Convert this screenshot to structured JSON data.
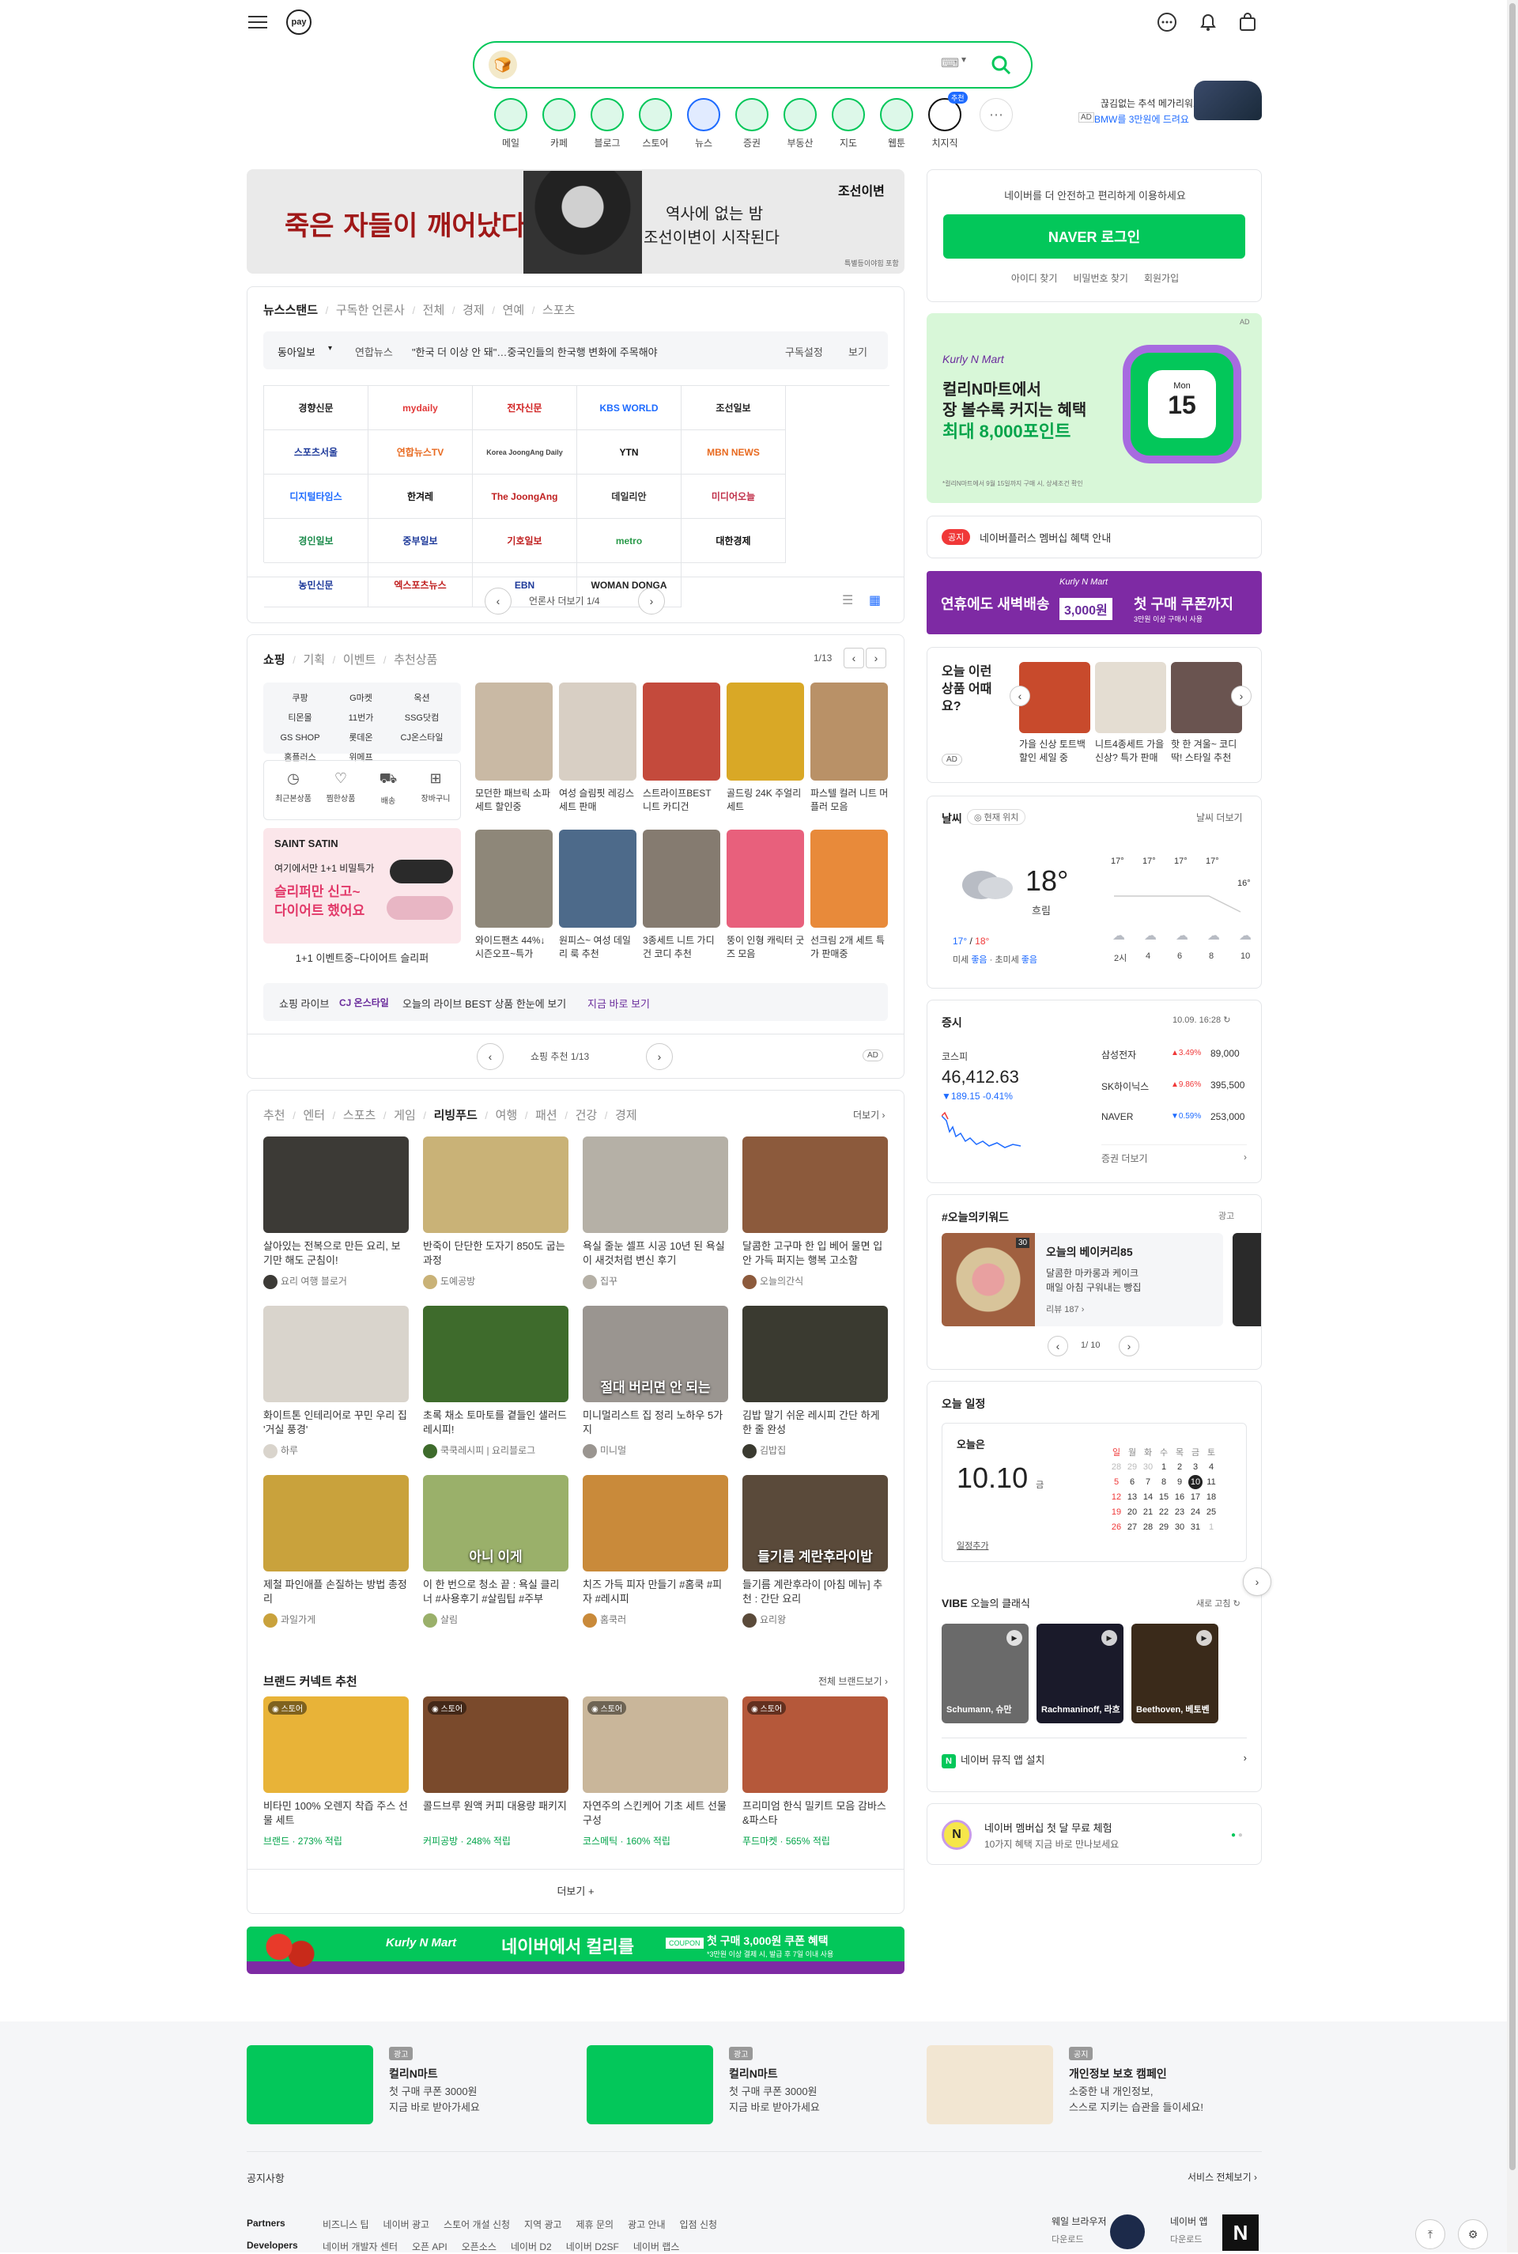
{
  "header": {
    "menu_icon": "hamburger-icon",
    "pay_label": "pay",
    "right_icons": [
      "chat-icon",
      "bell-icon",
      "shopping-bag-icon"
    ]
  },
  "search": {
    "placeholder": "",
    "keyboard_label": "⌨"
  },
  "services": [
    {
      "label": "메일",
      "color": "#03c75a"
    },
    {
      "label": "카페",
      "color": "#03c75a"
    },
    {
      "label": "블로그",
      "color": "#03c75a"
    },
    {
      "label": "스토어",
      "color": "#03c75a"
    },
    {
      "label": "뉴스",
      "color": "#1e6bff"
    },
    {
      "label": "증권",
      "color": "#03c75a"
    },
    {
      "label": "부동산",
      "color": "#03c75a"
    },
    {
      "label": "지도",
      "color": "#03c75a"
    },
    {
      "label": "웹툰",
      "color": "#03c75a"
    },
    {
      "label": "치지직",
      "color": "#111",
      "badge": "추천"
    }
  ],
  "top_ad": {
    "line1": "끊김없는 추석 메가리워드",
    "ad": "AD",
    "line2": "BMW를 3만원에 드려요"
  },
  "banner": {
    "title": "죽은 자들이 깨어났다",
    "line1": "역사에 없는 밤",
    "line2": "조선이변이 시작된다",
    "logo": "조선이변",
    "note": "특별등이야힘 포함"
  },
  "news": {
    "tabs": [
      "뉴스스탠드",
      "구독한 언론사",
      "전체",
      "경제",
      "연예",
      "스포츠"
    ],
    "ticker_source": "연합뉴스",
    "ticker_label": "동아일보",
    "headline": "\"한국 더 이상 안 돼\"…중국인들의 한국행 변화에 주목해야",
    "right_links": [
      "구독설정",
      "보기"
    ],
    "press": [
      "경향신문",
      "mydaily",
      "전자신문",
      "KBS WORLD",
      "조선일보",
      "스포츠서울",
      "연합뉴스TV",
      "Korea JoongAng Daily",
      "YTN",
      "MBN NEWS",
      "디지털타임스",
      "한겨레",
      "The JoongAng",
      "데일리안",
      "미디어오늘",
      "경인일보",
      "중부일보",
      "기호일보",
      "metro",
      "대한경제",
      "농민신문",
      "엑스포츠뉴스",
      "EBN",
      "WOMAN DONGA"
    ],
    "pager": "언론사 더보기 1/4",
    "view_icons": [
      "list-view-icon",
      "grid-view-icon"
    ]
  },
  "shopping": {
    "tabs": [
      "쇼핑",
      "기획",
      "이벤트",
      "추천상품"
    ],
    "page": "1/13",
    "malls": [
      "쿠팡",
      "G마켓",
      "옥션",
      "티몬몰",
      "11번가",
      "SSG닷컴",
      "GS SHOP",
      "롯데온",
      "CJ온스타일",
      "홈플러스",
      "위메프"
    ],
    "shortcuts": [
      "최근본상품",
      "찜한상품",
      "배송",
      "장바구니"
    ],
    "promo_brand": "SAINT SATIN",
    "promo_line1": "여기에서만 1+1 비밀특가",
    "promo_line2": "슬리퍼만 신고~",
    "promo_line3": "다이어트 했어요",
    "promo_caption": "1+1 이벤트중~다이어트 슬리퍼",
    "products": [
      {
        "name": "모던한 패브릭 소파 세트 할인중",
        "color": "#c9b9a4"
      },
      {
        "name": "여성 슬림핏 레깅스 세트 판매",
        "color": "#d8cfc4"
      },
      {
        "name": "스트라이프BEST 니트 카디건",
        "color": "#c44a3c"
      },
      {
        "name": "골드링 24K 주얼리 세트",
        "color": "#d9a826"
      },
      {
        "name": "파스텔 컬러 니트 머플러 모음",
        "color": "#b99167"
      },
      {
        "name": "와이드팬츠 44%↓ 시즌오프~특가",
        "color": "#8e8779"
      },
      {
        "name": "원피스~ 여성 데일리 룩 추천",
        "color": "#4d6a8a"
      },
      {
        "name": "3종세트 니트 가디건 코디 추천",
        "color": "#857b70"
      },
      {
        "name": "뚱이 인형 캐릭터 굿즈 모음",
        "color": "#e8607c"
      },
      {
        "name": "선크림 2개 세트 특가 판매중",
        "color": "#e88a3a"
      }
    ],
    "banner_label": "쇼핑 라이브",
    "banner_brand": "CJ 온스타일",
    "banner_text": "오늘의 라이브 BEST 상품 한눈에 보기",
    "banner_link": "지금 바로 보기",
    "pager": "쇼핑 추천 1/13",
    "ad": "AD"
  },
  "contents": {
    "tabs": [
      "추천",
      "엔터",
      "스포츠",
      "게임",
      "리빙푸드",
      "여행",
      "패션",
      "건강",
      "경제"
    ],
    "more": "더보기",
    "items": [
      {
        "caption": "살아있는 전복으로 만든 요리, 보기만 해도 군침이!",
        "author": "요리 여행 블로거",
        "color": "#3c3a36"
      },
      {
        "caption": "반죽이 단단한 도자기 850도 굽는 과정",
        "author": "도예공방",
        "color": "#c9b277"
      },
      {
        "caption": "욕실 줄눈 셀프 시공 10년 된 욕실이 새것처럼 변신 후기",
        "author": "집꾸",
        "color": "#b5b0a6"
      },
      {
        "caption": "달콤한 고구마 한 입 베어 물면 입안 가득 퍼지는 행복 고소함",
        "author": "오늘의간식",
        "color": "#8c5a3c"
      },
      {
        "caption": "화이트톤 인테리어로 꾸민 우리 집 '거실 풍경'",
        "author": "하루",
        "color": "#d9d4cc"
      },
      {
        "caption": "초록 채소 토마토를 곁들인 샐러드 레시피!",
        "author": "쿡쿡레시피 | 요리블로그",
        "color": "#3e6b2c"
      },
      {
        "caption": "미니멀리스트 집 정리 노하우 5가지",
        "author": "미니멀",
        "color": "#9a9590"
      },
      {
        "caption": "김밥 말기 쉬운 레시피 간단 하게 한 줄 완성",
        "author": "김밥집",
        "color": "#3a3a30"
      },
      {
        "caption": "제철 파인애플 손질하는 방법 총정리",
        "author": "과일가게",
        "color": "#c9a23c"
      },
      {
        "caption": "이 한 번으로 청소 끝 : 욕실 클리너 #사용후기 #살림팁 #주부",
        "author": "살림",
        "color": "#9ab06a"
      },
      {
        "caption": "치즈 가득 피자 만들기 #홈쿡 #피자 #레시피",
        "author": "홈쿡러",
        "color": "#c98a3a"
      },
      {
        "caption": "들기름 계란후라이 [아침 메뉴] 추천 : 간단 요리",
        "author": "요리왕",
        "color": "#5a4a3a"
      }
    ],
    "overlays": [
      "절대 버리면 안 되는",
      "아니 이게",
      "들기름 계란후라이밥"
    ],
    "shop_title": "브랜드 커넥트 추천",
    "shop_more": "전체 브랜드보기",
    "shop_items": [
      {
        "caption": "비타민 100% 오렌지 착즙 주스 선물 세트",
        "meta": "브랜드 · 273% 적립",
        "color": "#e8b338"
      },
      {
        "caption": "콜드브루 원액 커피 대용량 패키지",
        "meta": "커피공방 · 248% 적립",
        "color": "#7a4a2c"
      },
      {
        "caption": "자연주의 스킨케어 기초 세트 선물 구성",
        "meta": "코스메틱 · 160% 적립",
        "color": "#c9b69a"
      },
      {
        "caption": "프리미엄 한식 밀키트 모음 감바스&파스타",
        "meta": "푸드마켓 · 565% 적립",
        "color": "#b5583a"
      }
    ],
    "load_more": "더보기 +"
  },
  "bottom_ad": {
    "brand": "Kurly N Mart",
    "text": "네이버에서 컬리를",
    "coupon": "COUPON",
    "offer": "첫 구매 3,000원 쿠폰 혜택",
    "note": "*3만원 이상 결제 시, 발급 후 7일 이내 사용"
  },
  "login": {
    "prompt": "네이버를 더 안전하고 편리하게 이용하세요",
    "button": "NAVER 로그인",
    "links": [
      "아이디 찾기",
      "비밀번호 찾기",
      "회원가입"
    ]
  },
  "kurly_ad": {
    "ad": "AD",
    "brand": "Kurly N Mart",
    "line1": "컬리N마트에서",
    "line2": "장 볼수록 커지는 혜택",
    "line3": "최대 8,000포인트",
    "calendar_month": "Mon",
    "calendar_day": "15",
    "fine_print": "*컬리N마트에서 9월 15일까지 구매 시, 상세조건 확인"
  },
  "notice": {
    "badge": "공지",
    "text": "네이버플러스 멤버십 혜택 안내"
  },
  "delivery_ad": {
    "text1": "연휴에도 새벽배송",
    "brand": "Kurly N Mart",
    "amount": "3,000원",
    "text2": "첫 구매 쿠폰까지",
    "note": "3만원 이상 구매시 사용"
  },
  "today_products": {
    "title": "오늘 이런 상품 어때요?",
    "ad": "AD",
    "items": [
      {
        "caption": "가을 신상 토트백 할인 세일 중",
        "color": "#c84a2c"
      },
      {
        "caption": "니트4종세트 가을 신상? 특가 판매",
        "color": "#e4ddd2"
      },
      {
        "caption": "핫 한 겨울~ 코디 딱! 스타일 추천",
        "color": "#6a5450"
      }
    ]
  },
  "weather": {
    "title": "날씨",
    "location": "현재 위치",
    "link": "날씨 더보기",
    "temp": "18°",
    "condition": "흐림",
    "low": "17°",
    "high": "18°",
    "dust_label": "미세",
    "dust_val": "좋음",
    "ultra_label": "초미세",
    "ultra_val": "좋음",
    "hourly": [
      {
        "temp": "17°",
        "time": "2시"
      },
      {
        "temp": "17°",
        "time": "4"
      },
      {
        "temp": "17°",
        "time": "6"
      },
      {
        "temp": "17°",
        "time": "8"
      },
      {
        "temp": "16°",
        "time": "10"
      }
    ]
  },
  "stock": {
    "title": "증시",
    "time": "10.09. 16:28",
    "index_name": "코스피",
    "index_val": "46,412.63",
    "index_change": "▼189.15 -0.41%",
    "items": [
      {
        "name": "삼성전자",
        "change": "▲3.49%",
        "price": "89,000"
      },
      {
        "name": "SK하이닉스",
        "change": "▲9.86%",
        "price": "395,500"
      },
      {
        "name": "NAVER",
        "change": "▼0.59%",
        "price": "253,000"
      }
    ],
    "more": "증권 더보기"
  },
  "hashtag": {
    "title": "#오늘의키워드",
    "page_label": "광고",
    "item_title": "오늘의 베이커리85",
    "item_line1": "달콤한 마카롱과 케이크",
    "item_line2": "매일 아침 구워내는 빵집",
    "item_meta": "리뷰 187",
    "badge": "30",
    "pager": "1/ 10"
  },
  "calendar": {
    "title": "오늘 일정",
    "today_label": "오늘은",
    "date": "10.10",
    "weekday": "금",
    "link": "일정추가",
    "head": [
      "일",
      "월",
      "화",
      "수",
      "목",
      "금",
      "토"
    ],
    "rows": [
      [
        "28",
        "29",
        "30",
        "1",
        "2",
        "3",
        "4"
      ],
      [
        "5",
        "6",
        "7",
        "8",
        "9",
        "10",
        "11"
      ],
      [
        "12",
        "13",
        "14",
        "15",
        "16",
        "17",
        "18"
      ],
      [
        "19",
        "20",
        "21",
        "22",
        "23",
        "24",
        "25"
      ],
      [
        "26",
        "27",
        "28",
        "29",
        "30",
        "31",
        "1"
      ]
    ]
  },
  "vibe": {
    "title": "VIBE",
    "subtitle": "오늘의 클래식",
    "refresh": "새로 고침",
    "albums": [
      {
        "caption": "Schumann, 슈만",
        "color": "#6a6a6a"
      },
      {
        "caption": "Rachmaninoff, 라흐마니노프",
        "color": "#1a1a2a"
      },
      {
        "caption": "Beethoven, 베토벤",
        "color": "#3a2a1a"
      }
    ],
    "link": "네이버 뮤직 앱 설치"
  },
  "promo_card": {
    "line1": "네이버 멤버십 첫 달 무료 체험",
    "line2": "10가지 혜택 지금 바로 만나보세요"
  },
  "footer_promos": [
    {
      "badge": "광고",
      "title": "컬리N마트",
      "line1": "첫 구매 쿠폰 3000원",
      "line2": "지금 바로 받아가세요",
      "color": "#03c75a"
    },
    {
      "badge": "광고",
      "title": "컬리N마트",
      "line1": "첫 구매 쿠폰 3000원",
      "line2": "지금 바로 받아가세요",
      "color": "#03c75a"
    },
    {
      "badge": "공지",
      "title": "개인정보 보호 캠페인",
      "line1": "소중한 내 개인정보,",
      "line2": "스스로 지키는 습관을 들이세요!",
      "color": "#f2e6d2"
    }
  ],
  "footer": {
    "notice_label": "공지사항",
    "notice_more": "서비스 전체보기",
    "partners_label": "Partners",
    "partners": [
      "비즈니스 팁",
      "네이버 광고",
      "스토어 개설 신청",
      "지역 광고",
      "제휴 문의",
      "광고 안내",
      "입점 신청"
    ],
    "developers_label": "Developers",
    "developers": [
      "네이버 개발자 센터",
      "오픈 API",
      "오픈소스",
      "네이버 D2",
      "네이버 D2SF",
      "네이버 랩스"
    ],
    "app_label": "네이버 앱",
    "app_sub": "다운로드",
    "whale_label": "웨일 브라우저",
    "whale_sub": "다운로드"
  }
}
